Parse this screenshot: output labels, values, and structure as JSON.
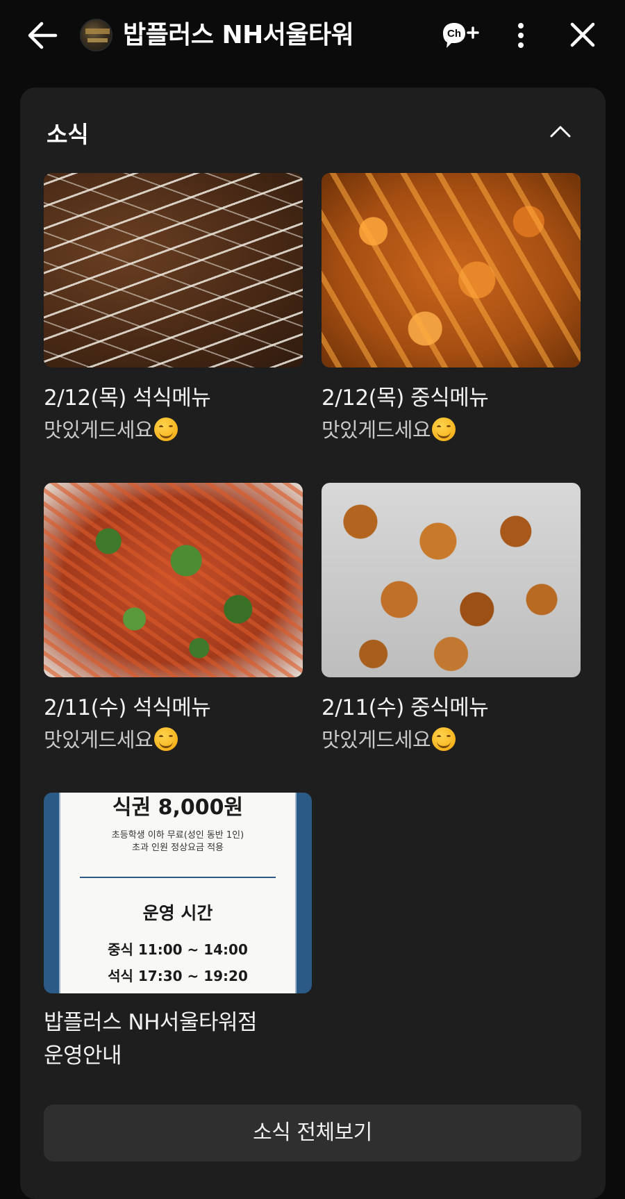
{
  "header": {
    "channel_name": "밥플러스 NH서울타워",
    "icons": {
      "back": "arrow-left-icon",
      "avatar": "channel-avatar",
      "chat_plus": "chat-add-icon",
      "more": "more-vertical-icon",
      "close": "close-icon"
    },
    "chat_plus_label": "Ch"
  },
  "section": {
    "title": "소식",
    "collapse_icon": "chevron-up-icon",
    "posts": [
      {
        "title": "2/12(목) 석식메뉴",
        "subtitle": "맛있게드세요",
        "emoji": "smiling-face-emoji",
        "photo": "cutlet-photo"
      },
      {
        "title": "2/12(목) 중식메뉴",
        "subtitle": "맛있게드세요",
        "emoji": "smiling-face-emoji",
        "photo": "fried-food-photo"
      },
      {
        "title": "2/11(수) 석식메뉴",
        "subtitle": "맛있게드세요",
        "emoji": "smiling-face-emoji",
        "photo": "spicy-stirfry-photo"
      },
      {
        "title": "2/11(수) 중식메뉴",
        "subtitle": "맛있게드세요",
        "emoji": "smiling-face-emoji",
        "photo": "nuggets-photo"
      },
      {
        "title": "밥플러스 NH서울타워점",
        "subtitle": "운영안내",
        "photo": "info-poster"
      }
    ],
    "poster": {
      "price": "식권 8,000원",
      "note1": "초등학생 이하 무료(성인 동반 1인)",
      "note2": "초과 인원 정상요금 적용",
      "heading": "운영 시간",
      "lunch": "중식 11:00 ~ 14:00",
      "dinner": "석식 17:30 ~ 19:20"
    },
    "view_all_label": "소식 전체보기"
  },
  "colors": {
    "background": "#0b0b0b",
    "card": "#1e1e1e",
    "button": "#2f2f2f",
    "subtitle_text": "#c9c9c9"
  }
}
